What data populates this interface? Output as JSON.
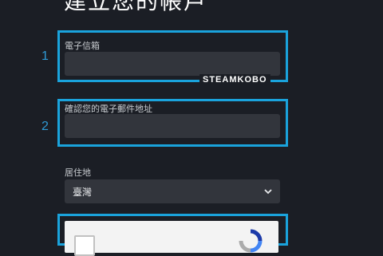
{
  "page": {
    "title": "建立您的帳戶"
  },
  "steps": [
    {
      "number": "1"
    },
    {
      "number": "2"
    }
  ],
  "form": {
    "email_label": "電子信箱",
    "email_value": "",
    "confirm_email_label": "確認您的電子郵件地址",
    "confirm_email_value": "",
    "country_label": "居住地",
    "country_value": "臺灣"
  },
  "watermark": "STEAMKOBO",
  "colors": {
    "background": "#1b1e25",
    "highlight": "#1aa3dc",
    "input": "#32353c"
  },
  "icons": {
    "select_chevron": "chevron-down-icon",
    "captcha_logo": "recaptcha-icon"
  }
}
